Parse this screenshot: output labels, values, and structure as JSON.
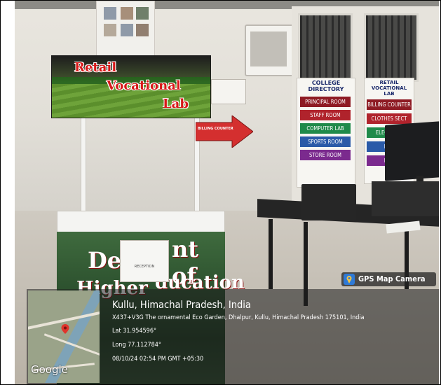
{
  "banner": {
    "line1": "Retail",
    "line2": "Vocational",
    "line3": "Lab"
  },
  "arrow_sign": {
    "label": "BILLING COUNTER"
  },
  "college_directory": {
    "title_line1": "COLLEGE",
    "title_line2": "DIRECTORY",
    "rooms": [
      {
        "label": "PRINCIPAL ROOM",
        "color": "#8e1b24"
      },
      {
        "label": "STAFF ROOM",
        "color": "#b0232c"
      },
      {
        "label": "COMPUTER LAB",
        "color": "#1f8a4a"
      },
      {
        "label": "SPORTS ROOM",
        "color": "#2a5aa8"
      },
      {
        "label": "STORE ROOM",
        "color": "#7b2a8e"
      }
    ]
  },
  "lab_directory": {
    "title_line1": "RETAIL",
    "title_line2": "VOCATIONAL",
    "title_line3": "LAB",
    "rooms": [
      {
        "label": "BILLING COUNTER",
        "color": "#8e1b24"
      },
      {
        "label": "CLOTHES SECT",
        "color": "#b0232c"
      },
      {
        "label": "ELECTRONI",
        "color": "#1f8a4a"
      },
      {
        "label": "FOO",
        "color": "#2a5aa8"
      },
      {
        "label": "FMC",
        "color": "#7b2a8e"
      }
    ]
  },
  "kiosk": {
    "text_top_left": "Dep",
    "text_top_right": "nt of",
    "text_bottom_left": "Higher",
    "text_bottom_right": "ducation",
    "reception_label": "RECEPTION"
  },
  "gps_overlay": {
    "badge_label": "GPS Map Camera",
    "location_title": "Kullu, Himachal Pradesh, India",
    "address": "X437+V3G The ornamental Eco Garden, Dhalpur, Kullu, Himachal Pradesh 175101, India",
    "latitude": "Lat 31.954596°",
    "longitude": "Long 77.112784°",
    "timestamp": "08/10/24 02:54 PM GMT +05:30",
    "map_brand": "Google"
  },
  "colors": {
    "banner_text": "#d81919",
    "arrow_red": "#d42f2f",
    "gps_icon_blue": "#2f7ad6",
    "map_pin": "#e0342c"
  }
}
